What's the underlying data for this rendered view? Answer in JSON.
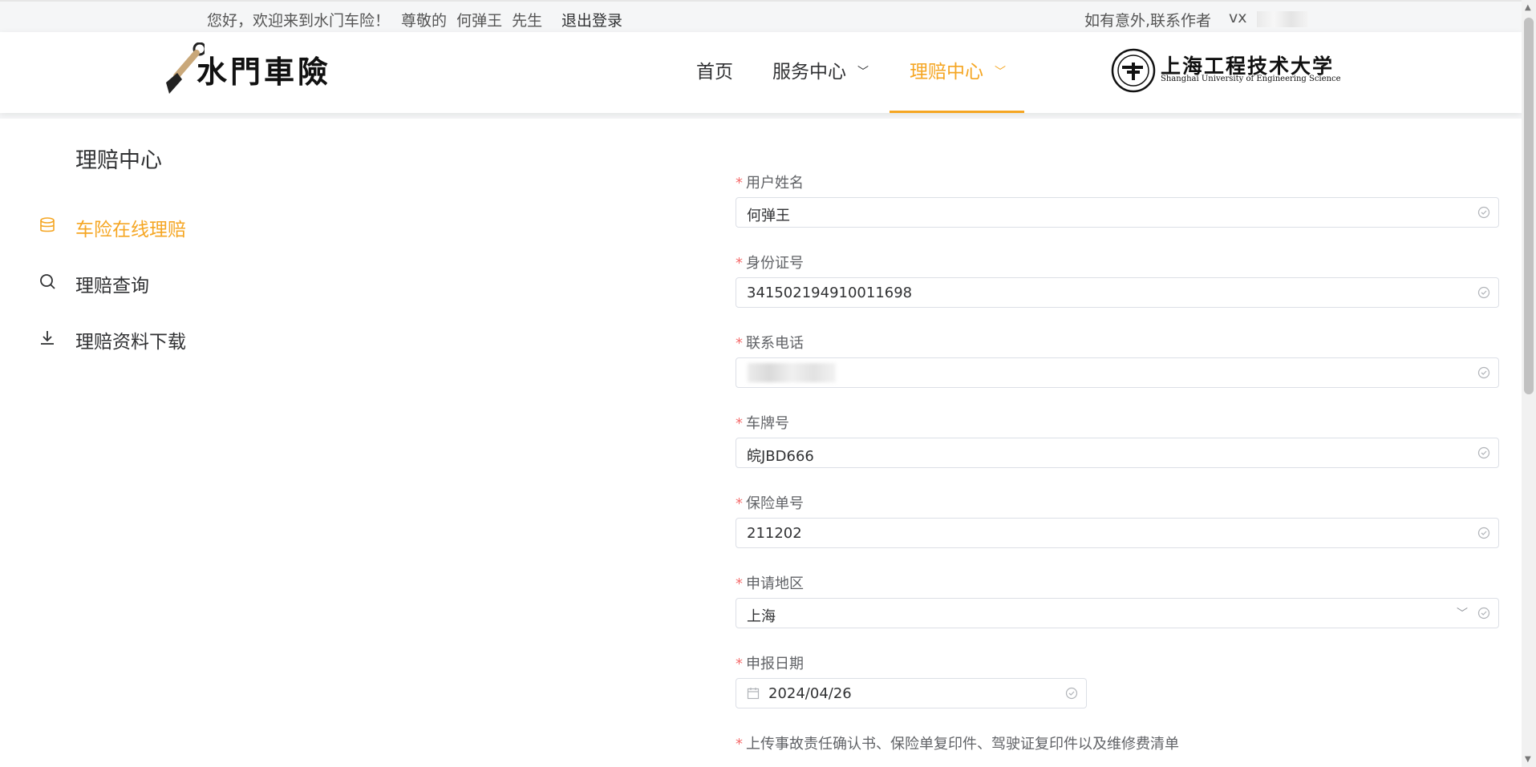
{
  "topbar": {
    "welcome": "您好，欢迎来到水门车险！",
    "greeting": "尊敬的  何弹王  先生",
    "logout": "退出登录",
    "contact": "如有意外,联系作者",
    "vx_label": "vx"
  },
  "header": {
    "logo_text": "水門車險",
    "nav": {
      "home": "首页",
      "service": "服务中心",
      "claim": "理赔中心"
    },
    "university_cn": "上海工程技术大学",
    "university_en": "Shanghai University of Engineering Science"
  },
  "sidebar": {
    "title": "理赔中心",
    "items": [
      {
        "label": "车险在线理赔",
        "icon": "database-icon",
        "active": true
      },
      {
        "label": "理赔查询",
        "icon": "search-icon",
        "active": false
      },
      {
        "label": "理赔资料下载",
        "icon": "download-icon",
        "active": false
      }
    ]
  },
  "form": {
    "required_mark": "*",
    "name": {
      "label": "用户姓名",
      "value": "何弹王"
    },
    "id_number": {
      "label": "身份证号",
      "value": "341502194910011698"
    },
    "phone": {
      "label": "联系电话",
      "value": ""
    },
    "plate": {
      "label": "车牌号",
      "value": "皖JBD666"
    },
    "policy": {
      "label": "保险单号",
      "value": "211202"
    },
    "region": {
      "label": "申请地区",
      "value": "上海"
    },
    "date": {
      "label": "申报日期",
      "value": "2024/04/26"
    },
    "upload": {
      "label": "上传事故责任确认书、保险单复印件、驾驶证复印件以及维修费清单"
    }
  },
  "colors": {
    "accent": "#f5a623",
    "required": "#f56c6c",
    "border": "#dcdfe6"
  }
}
